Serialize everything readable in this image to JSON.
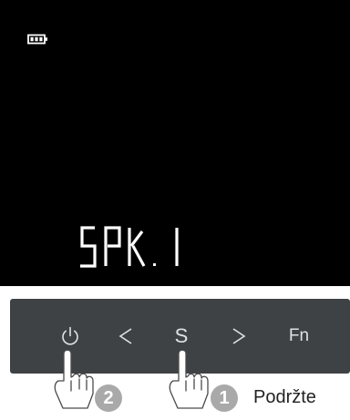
{
  "display": {
    "status_icon": "battery-icon",
    "text": "SPK.1"
  },
  "controls": {
    "power": {
      "icon": "power-icon"
    },
    "prev": {
      "label": "<"
    },
    "s": {
      "label": "S"
    },
    "next": {
      "label": ">"
    },
    "fn": {
      "label": "Fn"
    }
  },
  "instructions": {
    "step_1": "1",
    "step_2": "2",
    "action": "Podržte"
  },
  "colors": {
    "screen": "#000000",
    "panel": "#3f4244",
    "key_text": "#dfe2e4",
    "badge": "#a9a9a9"
  }
}
